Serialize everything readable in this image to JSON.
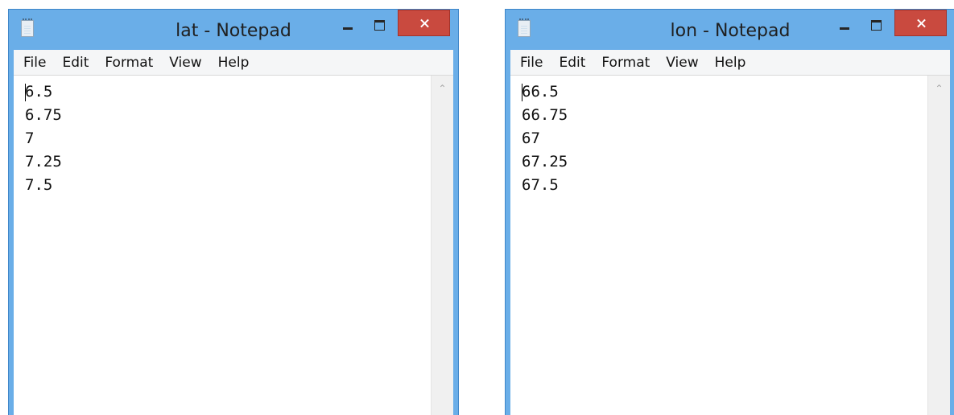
{
  "windows": [
    {
      "title": "lat - Notepad",
      "menu": [
        "File",
        "Edit",
        "Format",
        "View",
        "Help"
      ],
      "lines": [
        "6.5",
        "6.75",
        "7",
        "7.25",
        "7.5"
      ],
      "icons": {
        "app": "notepad-icon",
        "minimize": "minimize-icon",
        "maximize": "maximize-icon",
        "close": "close-icon",
        "scroll_up": "chevron-up-icon"
      }
    },
    {
      "title": "lon - Notepad",
      "menu": [
        "File",
        "Edit",
        "Format",
        "View",
        "Help"
      ],
      "lines": [
        "66.5",
        "66.75",
        "67",
        "67.25",
        "67.5"
      ],
      "icons": {
        "app": "notepad-icon",
        "minimize": "minimize-icon",
        "maximize": "maximize-icon",
        "close": "close-icon",
        "scroll_up": "chevron-up-icon"
      }
    }
  ],
  "colors": {
    "frame": "#6aaee8",
    "close_button": "#c94a3f",
    "menubar": "#f5f6f7",
    "scrollbar": "#f0f0f0"
  }
}
